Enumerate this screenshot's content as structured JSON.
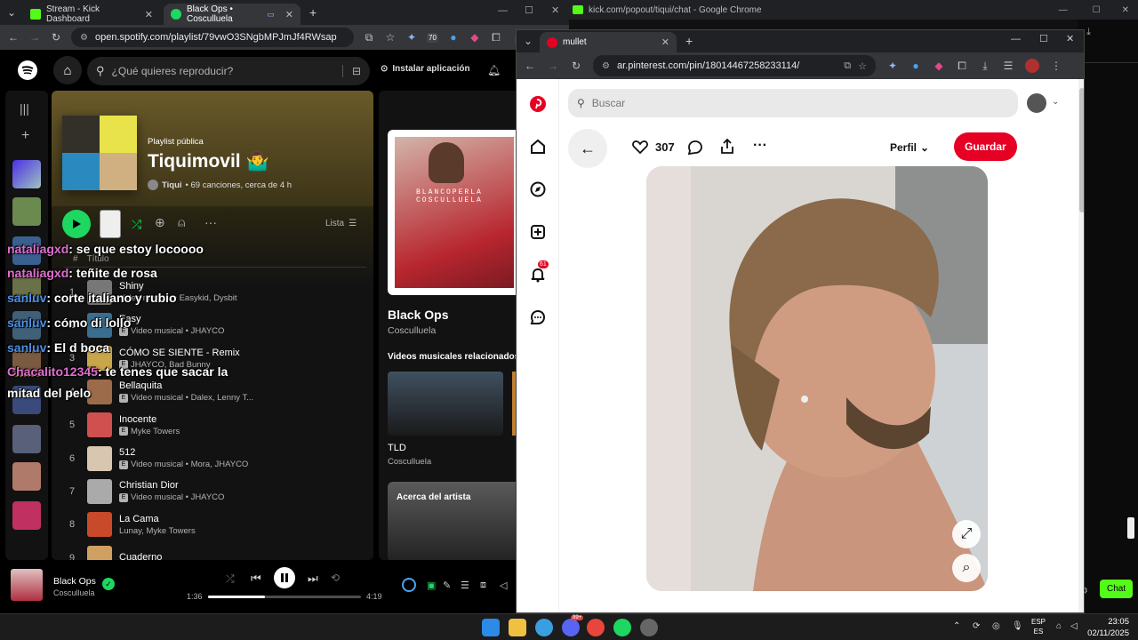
{
  "spotify_browser": {
    "tabs": [
      {
        "title": "Stream - Kick Dashboard",
        "icon": "kick-icon",
        "color": "#53fc18"
      },
      {
        "title": "Black Ops • Cosculluela",
        "icon": "spotify-icon",
        "color": "#1ed760"
      }
    ],
    "url": "open.spotify.com/playlist/79vwO3SNgbMPJmJf4RWsap",
    "ext_badge": "70"
  },
  "spotify": {
    "search_placeholder": "¿Qué quieres reproducir?",
    "install_label": "Instalar aplicación",
    "playlist": {
      "kind": "Playlist pública",
      "title": "Tiquimovil 🤷‍♂️",
      "owner": "Tiqui",
      "meta": " • 69 canciones, cerca de 4 h",
      "view_label": "Lista",
      "col_title": "Título"
    },
    "tracks": [
      {
        "num": "1",
        "title": "Shiny",
        "artists": "Video musical • Easykid, Dysbit",
        "explicit": false,
        "color": "#777"
      },
      {
        "num": "2",
        "title": "Easy",
        "artists": "Video musical • JHAYCO",
        "explicit": true,
        "color": "#3a6e8f"
      },
      {
        "num": "3",
        "title": "CÓMO SE SIENTE - Remix",
        "artists": "JHAYCO, Bad Bunny",
        "explicit": true,
        "color": "#c9a64a"
      },
      {
        "num": "4",
        "title": "Bellaquita",
        "artists": "Video musical • Dalex, Lenny T...",
        "explicit": true,
        "color": "#9b6b4a"
      },
      {
        "num": "5",
        "title": "Inocente",
        "artists": "Myke Towers",
        "explicit": true,
        "color": "#d05050"
      },
      {
        "num": "6",
        "title": "512",
        "artists": "Video musical • Mora, JHAYCO",
        "explicit": true,
        "color": "#d8c6b0"
      },
      {
        "num": "7",
        "title": "Christian Dior",
        "artists": "Video musical • JHAYCO",
        "explicit": true,
        "color": "#aaaaaa"
      },
      {
        "num": "8",
        "title": "La Cama",
        "artists": "Lunay, Myke Towers",
        "explicit": false,
        "color": "#c94a2a"
      },
      {
        "num": "9",
        "title": "Cuaderno",
        "artists": "",
        "explicit": false,
        "color": "#d0a060"
      }
    ],
    "right_panel": {
      "album_art_text": "BLANCOPERLA COSCULLUELA",
      "title": "Black Ops",
      "artist": "Cosculluela",
      "related_header": "Videos musicales relacionados",
      "related_title": "TLD",
      "related_artist": "Cosculluela",
      "about_artist": "Acerca del artista"
    },
    "now_playing": {
      "title": "Black Ops",
      "artist": "Cosculluela",
      "elapsed": "1:36",
      "duration": "4:19",
      "progress": 0.37
    }
  },
  "chat_overlay": [
    {
      "user": "nataliagxd",
      "text": ": se que estoy locoooo",
      "color": "pink"
    },
    {
      "user": "nataliagxd",
      "text": ": teñite de rosa",
      "color": "pink"
    },
    {
      "user": "sanluv",
      "text": ": corte italiano y rubio",
      "color": "blue"
    },
    {
      "user": "sanluv",
      "text": ": cómo di lollo",
      "color": "blue"
    },
    {
      "user": "sanluv",
      "text": ": El d boca",
      "color": "blue"
    },
    {
      "user": "Chacalito12345",
      "text": ": te tenes que sacar la",
      "color": "pink"
    },
    {
      "user": "",
      "text": "mitad del pelo",
      "color": "pink"
    }
  ],
  "kick_window": {
    "title": "kick.com/popout/tiqui/chat - Google Chrome",
    "chat_button": "Chat"
  },
  "pinterest_browser": {
    "tab_title": "mullet",
    "url": "ar.pinterest.com/pin/18014467258233114/"
  },
  "pinterest": {
    "search_placeholder": "Buscar",
    "notification_count": "61",
    "likes": "307",
    "profile_label": "Perfil",
    "save_label": "Guardar",
    "pin_title": "mullet"
  },
  "taskbar": {
    "lang": "ESP",
    "lang2": "ES",
    "time": "23:05",
    "date": "02/11/2025",
    "badge": "99+"
  }
}
